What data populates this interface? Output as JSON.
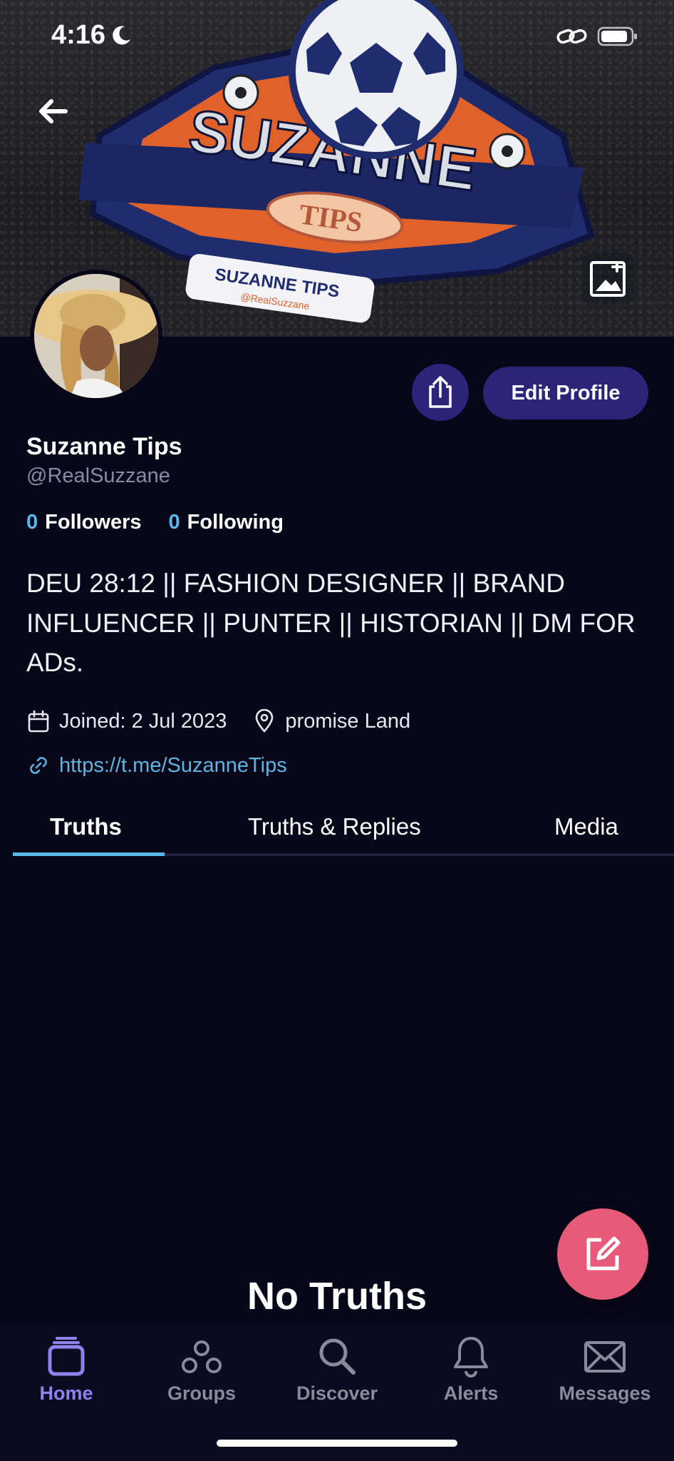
{
  "status_bar": {
    "time": "4:16"
  },
  "banner": {
    "brand_main": "SUZANNE",
    "brand_sub": "TIPS",
    "tag_text": "SUZANNE TIPS",
    "tag_handle": "@RealSuzzane"
  },
  "profile": {
    "display_name": "Suzanne Tips",
    "handle": "@RealSuzzane",
    "followers_count": "0",
    "followers_label": "Followers",
    "following_count": "0",
    "following_label": "Following",
    "bio": "DEU 28:12 || FASHION DESIGNER || BRAND INFLUENCER || PUNTER || HISTORIAN || DM FOR ADs.",
    "joined": "Joined: 2 Jul 2023",
    "location": "promise Land",
    "link": "https://t.me/SuzanneTips",
    "edit_button": "Edit Profile"
  },
  "tabs": [
    {
      "label": "Truths",
      "active": true
    },
    {
      "label": "Truths & Replies",
      "active": false
    },
    {
      "label": "Media",
      "active": false
    }
  ],
  "empty_state": {
    "title": "No Truths"
  },
  "bottom_nav": [
    {
      "label": "Home",
      "icon": "home-icon",
      "active": true
    },
    {
      "label": "Groups",
      "icon": "groups-icon",
      "active": false
    },
    {
      "label": "Discover",
      "icon": "search-icon",
      "active": false
    },
    {
      "label": "Alerts",
      "icon": "bell-icon",
      "active": false
    },
    {
      "label": "Messages",
      "icon": "envelope-icon",
      "active": false
    }
  ],
  "colors": {
    "background": "#080619",
    "accent": "#58b8e8",
    "button": "#2b2478",
    "fab": "#e85a7a",
    "nav_active": "#8e82ee"
  }
}
